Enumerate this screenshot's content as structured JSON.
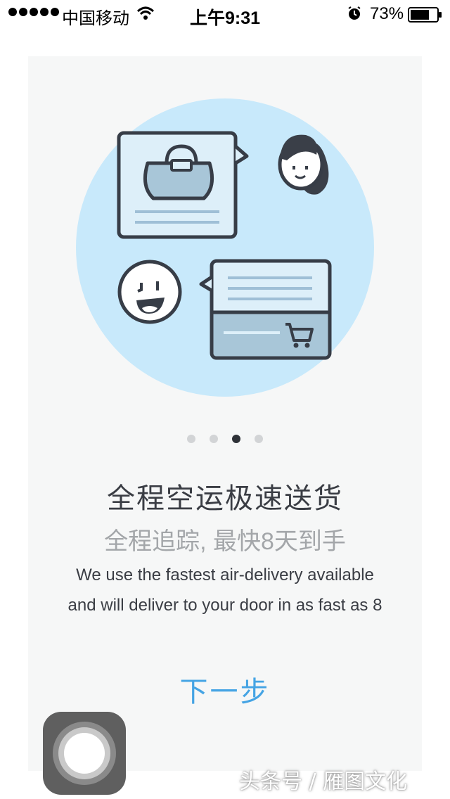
{
  "status_bar": {
    "carrier": "中国移动",
    "time": "上午9:31",
    "battery_percent": "73%",
    "battery_level": 0.73,
    "icons": [
      "signal-dots-icon",
      "wifi-icon",
      "alarm-icon",
      "battery-icon"
    ]
  },
  "onboarding": {
    "page_indicator": {
      "total": 4,
      "active_index": 2
    },
    "title": "全程空运极速送货",
    "subtitle": "全程追踪, 最快8天到手",
    "description_line1": "We use the fastest air-delivery available",
    "description_line2": "and will deliver to your door in as fast as 8",
    "next_button": "下一步",
    "illustration_icons": [
      "handbag-icon",
      "woman-avatar-icon",
      "smiley-face-icon",
      "shopping-cart-icon",
      "chat-bubble-icon"
    ]
  },
  "watermark": "头条号 / 雁图文化",
  "colors": {
    "accent": "#45a4e4",
    "circle": "#c8e9fb",
    "card_bg": "#f6f7f7",
    "outline": "#373d47"
  }
}
